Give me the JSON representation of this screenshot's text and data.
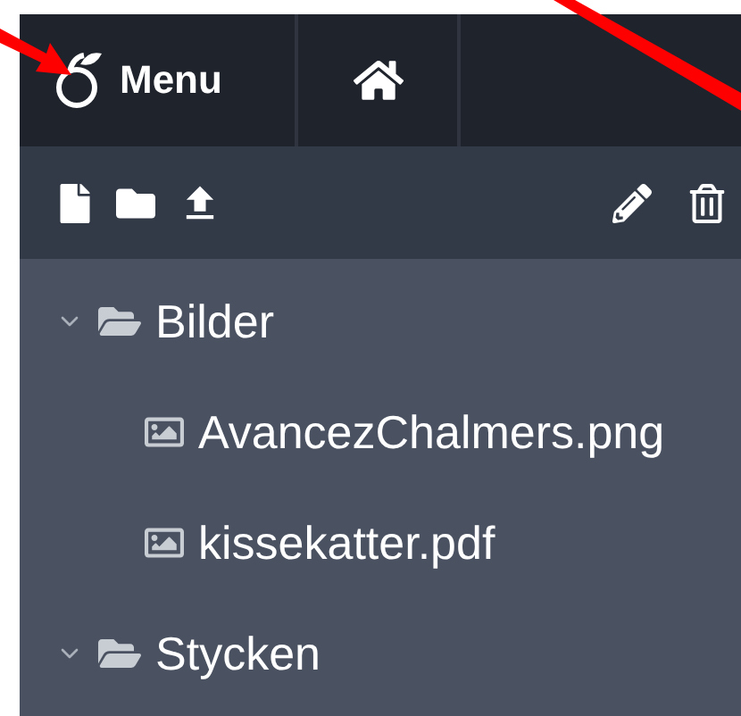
{
  "header": {
    "menu_label": "Menu"
  },
  "tree": [
    {
      "kind": "folder",
      "name": "Bilder",
      "expanded": true,
      "children": [
        {
          "kind": "image",
          "name": "AvancezChalmers.png"
        },
        {
          "kind": "image",
          "name": "kissekatter.pdf"
        }
      ]
    },
    {
      "kind": "folder",
      "name": "Stycken",
      "expanded": true
    }
  ]
}
